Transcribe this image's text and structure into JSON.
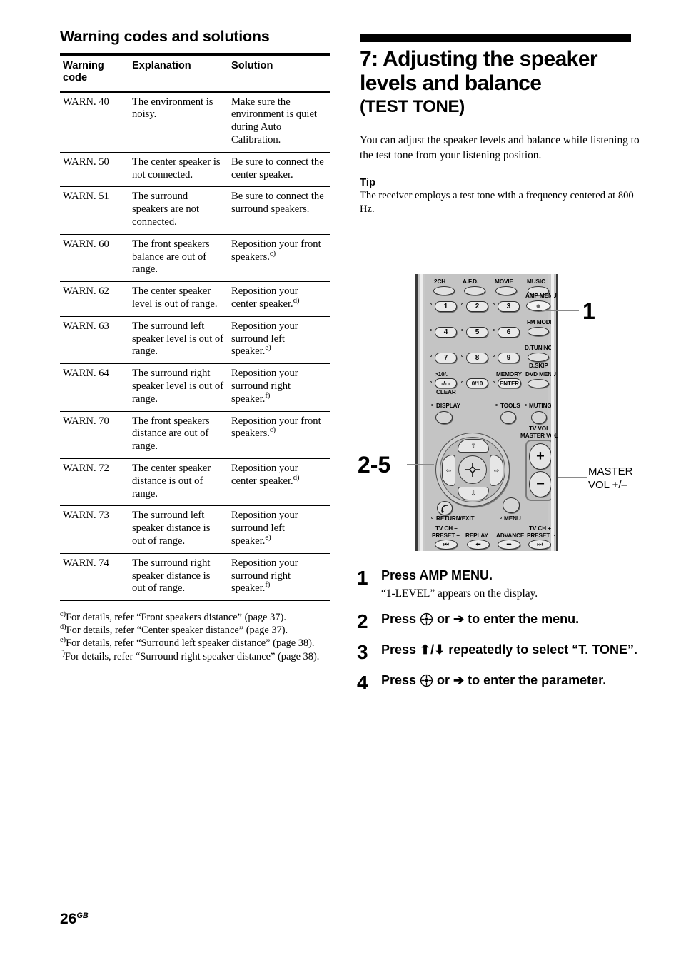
{
  "left": {
    "section_title": "Warning codes and solutions",
    "table": {
      "headers": [
        "Warning code",
        "Explanation",
        "Solution"
      ],
      "rows": [
        {
          "code": "WARN. 40",
          "explanation": "The environment is noisy.",
          "solution": "Make sure the environment is quiet during Auto Calibration.",
          "footnote": ""
        },
        {
          "code": "WARN. 50",
          "explanation": "The center speaker is not connected.",
          "solution": "Be sure to connect the center speaker.",
          "footnote": ""
        },
        {
          "code": "WARN. 51",
          "explanation": "The surround speakers are not connected.",
          "solution": "Be sure to connect the surround speakers.",
          "footnote": ""
        },
        {
          "code": "WARN. 60",
          "explanation": "The front speakers balance are out of range.",
          "solution": "Reposition your front speakers.",
          "footnote": "c)"
        },
        {
          "code": "WARN. 62",
          "explanation": "The center speaker level is out of range.",
          "solution": "Reposition your center speaker.",
          "footnote": "d)"
        },
        {
          "code": "WARN. 63",
          "explanation": "The surround left speaker level is out of range.",
          "solution": "Reposition your surround left speaker.",
          "footnote": "e)"
        },
        {
          "code": "WARN. 64",
          "explanation": "The surround right speaker level is out of range.",
          "solution": "Reposition your surround right speaker.",
          "footnote": "f)"
        },
        {
          "code": "WARN. 70",
          "explanation": "The front speakers distance are out of range.",
          "solution": "Reposition your front speakers.",
          "footnote": "c)"
        },
        {
          "code": "WARN. 72",
          "explanation": "The center speaker distance is out of range.",
          "solution": "Reposition your center speaker.",
          "footnote": "d)"
        },
        {
          "code": "WARN. 73",
          "explanation": "The surround left speaker distance is out of range.",
          "solution": "Reposition your surround left speaker.",
          "footnote": "e)"
        },
        {
          "code": "WARN. 74",
          "explanation": "The surround right speaker distance is out of range.",
          "solution": "Reposition your surround right speaker.",
          "footnote": "f)"
        }
      ]
    },
    "footnotes": [
      {
        "mark": "c)",
        "text": "For details, refer “Front speakers distance” (page 37)."
      },
      {
        "mark": "d)",
        "text": "For details, refer “Center speaker distance” (page 37)."
      },
      {
        "mark": "e)",
        "text": "For details, refer “Surround left speaker distance” (page 38)."
      },
      {
        "mark": "f)",
        "text": "For details, refer “Surround right speaker distance” (page 38)."
      }
    ]
  },
  "right": {
    "chapter_title": "7: Adjusting the speaker levels and balance",
    "chapter_subtitle": "(TEST TONE)",
    "intro": "You can adjust the speaker levels and balance while listening to the test tone from your listening position.",
    "tip_heading": "Tip",
    "tip_body": "The receiver employs a test tone with a frequency centered at 800 Hz."
  },
  "diagram": {
    "callout_1": "1",
    "callout_2_5": "2-5",
    "callout_master_vol": "MASTER VOL +/–",
    "remote": {
      "mode_buttons": [
        "2CH",
        "A.F.D.",
        "MOVIE",
        "MUSIC"
      ],
      "numeric": [
        "1",
        "2",
        "3",
        "4",
        "5",
        "6",
        "7",
        "8",
        "9"
      ],
      "amp_menu_label": "AMP MENU",
      "fm_mode_label": "FM MODE",
      "d_tuning_label": "D.TUNING",
      "d_skip_label": "D.SKIP",
      "dvd_menu_label": "DVD MENU",
      "key_10_top": ">10/.",
      "key_10_bottom": "-/- -",
      "clear_label": "CLEAR",
      "key_0_10": "0/10",
      "memory_label": "MEMORY",
      "enter_label": "ENTER",
      "display_label": "DISPLAY",
      "tools_label": "TOOLS",
      "muting_label": "MUTING",
      "tv_vol_label": "TV VOL",
      "master_vol_label": "MASTER VOL",
      "vol_plus": "+",
      "vol_minus": "−",
      "return_exit_label": "RETURN/EXIT",
      "menu_label": "MENU",
      "tv_ch_minus": "TV CH –",
      "preset_minus": "PRESET –",
      "replay_label": "REPLAY",
      "advance_label": "ADVANCE",
      "tv_ch_plus": "TV CH +",
      "preset_plus": "PRESET +"
    }
  },
  "steps": [
    {
      "num": "1",
      "head": "Press AMP MENU.",
      "sub": "“1-LEVEL” appears on the display.",
      "head_pre": "",
      "head_post": ""
    },
    {
      "num": "2",
      "head_pre": "Press ",
      "head_post": " or ➔ to enter the menu.",
      "sub": ""
    },
    {
      "num": "3",
      "head": "Press ⬆/⬇ repeatedly to select “T. TONE”.",
      "sub": ""
    },
    {
      "num": "4",
      "head_pre": "Press ",
      "head_post": " or ➔ to enter the parameter.",
      "sub": ""
    }
  ],
  "footer": {
    "page": "26",
    "edition": "GB"
  }
}
